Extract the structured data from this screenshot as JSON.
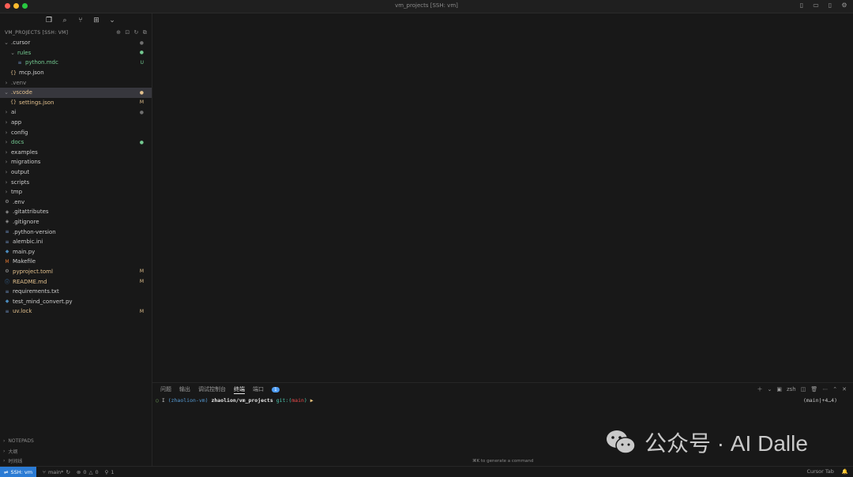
{
  "window": {
    "title": "vm_projects [SSH: vm]"
  },
  "explorer": {
    "header": "VM_PROJECTS [SSH: VM]",
    "rows": [
      {
        "name": ".cursor",
        "kind": "folder-open",
        "indent": 1,
        "status": "●",
        "status_type": "dot",
        "color": "#cccccc"
      },
      {
        "name": "rules",
        "kind": "folder-open",
        "indent": 2,
        "status": "●",
        "status_type": "dot",
        "color": "#73c991"
      },
      {
        "name": "python.mdc",
        "kind": "file-lines",
        "indent": 3,
        "status": "U",
        "status_type": "untracked",
        "color": "#73c991"
      },
      {
        "name": "mcp.json",
        "kind": "json",
        "indent": 2,
        "status": "",
        "status_type": "",
        "color": "#cccccc"
      },
      {
        "name": ".venv",
        "kind": "folder",
        "indent": 1,
        "status": "",
        "status_type": "",
        "color": "#8a8a8a"
      },
      {
        "name": ".vscode",
        "kind": "folder-open",
        "indent": 1,
        "status": "●",
        "status_type": "dot",
        "color": "#e2c08d",
        "selected": true
      },
      {
        "name": "settings.json",
        "kind": "json",
        "indent": 2,
        "status": "M",
        "status_type": "mod",
        "color": "#e2c08d"
      },
      {
        "name": "ai",
        "kind": "folder",
        "indent": 1,
        "status": "●",
        "status_type": "dot",
        "color": "#cccccc"
      },
      {
        "name": "app",
        "kind": "folder",
        "indent": 1,
        "status": "",
        "status_type": "",
        "color": "#cccccc"
      },
      {
        "name": "config",
        "kind": "folder",
        "indent": 1,
        "status": "",
        "status_type": "",
        "color": "#cccccc"
      },
      {
        "name": "docs",
        "kind": "folder",
        "indent": 1,
        "status": "●",
        "status_type": "dot",
        "color": "#73c991"
      },
      {
        "name": "examples",
        "kind": "folder",
        "indent": 1,
        "status": "",
        "status_type": "",
        "color": "#cccccc"
      },
      {
        "name": "migrations",
        "kind": "folder",
        "indent": 1,
        "status": "",
        "status_type": "",
        "color": "#cccccc"
      },
      {
        "name": "output",
        "kind": "folder",
        "indent": 1,
        "status": "",
        "status_type": "",
        "color": "#cccccc"
      },
      {
        "name": "scripts",
        "kind": "folder",
        "indent": 1,
        "status": "",
        "status_type": "",
        "color": "#cccccc"
      },
      {
        "name": "tmp",
        "kind": "folder",
        "indent": 1,
        "status": "",
        "status_type": "",
        "color": "#cccccc"
      },
      {
        "name": ".env",
        "kind": "gear",
        "indent": 1,
        "status": "",
        "status_type": "",
        "color": "#cccccc"
      },
      {
        "name": ".gitattributes",
        "kind": "git",
        "indent": 1,
        "status": "",
        "status_type": "",
        "color": "#cccccc"
      },
      {
        "name": ".gitignore",
        "kind": "git",
        "indent": 1,
        "status": "",
        "status_type": "",
        "color": "#cccccc"
      },
      {
        "name": ".python-version",
        "kind": "file-lines",
        "indent": 1,
        "status": "",
        "status_type": "",
        "color": "#cccccc"
      },
      {
        "name": "alembic.ini",
        "kind": "file-lines",
        "indent": 1,
        "status": "",
        "status_type": "",
        "color": "#cccccc"
      },
      {
        "name": "main.py",
        "kind": "python",
        "indent": 1,
        "status": "",
        "status_type": "",
        "color": "#cccccc"
      },
      {
        "name": "Makefile",
        "kind": "makefile",
        "indent": 1,
        "status": "",
        "status_type": "",
        "color": "#cccccc"
      },
      {
        "name": "pyproject.toml",
        "kind": "gear",
        "indent": 1,
        "status": "M",
        "status_type": "mod",
        "color": "#e2c08d"
      },
      {
        "name": "README.md",
        "kind": "info",
        "indent": 1,
        "status": "M",
        "status_type": "mod",
        "color": "#e2c08d"
      },
      {
        "name": "requirements.txt",
        "kind": "file-lines",
        "indent": 1,
        "status": "",
        "status_type": "",
        "color": "#cccccc"
      },
      {
        "name": "test_mind_convert.py",
        "kind": "python",
        "indent": 1,
        "status": "",
        "status_type": "",
        "color": "#cccccc"
      },
      {
        "name": "uv.lock",
        "kind": "file-lines",
        "indent": 1,
        "status": "M",
        "status_type": "mod",
        "color": "#e2c08d"
      }
    ]
  },
  "sidebar_footer": {
    "notepads": "NOTEPADS",
    "outline": "大纲",
    "timeline": "时间线"
  },
  "panel": {
    "tabs": [
      {
        "label": "问题",
        "active": false
      },
      {
        "label": "输出",
        "active": false
      },
      {
        "label": "调试控制台",
        "active": false
      },
      {
        "label": "终端",
        "active": true
      },
      {
        "label": "端口",
        "active": false
      }
    ],
    "ports_badge": "1",
    "shell_label": "zsh",
    "terminal": {
      "user_host": "(zhaolion-vm)",
      "path": "zhaolion/vm_projects",
      "git_label": "git:",
      "branch_open": "(",
      "branch": "main",
      "branch_close": ")",
      "prompt_arrow": "▶",
      "right_prompt": "(main|+4…4)"
    },
    "generate_hint": "⌘K to generate a command"
  },
  "statusbar": {
    "remote": "SSH: vm",
    "branch": "main*",
    "errors": "0",
    "warnings": "0",
    "ports": "1",
    "cursor_tab": "Cursor Tab"
  },
  "watermark": {
    "text": "公众号 · AI Dalle"
  }
}
